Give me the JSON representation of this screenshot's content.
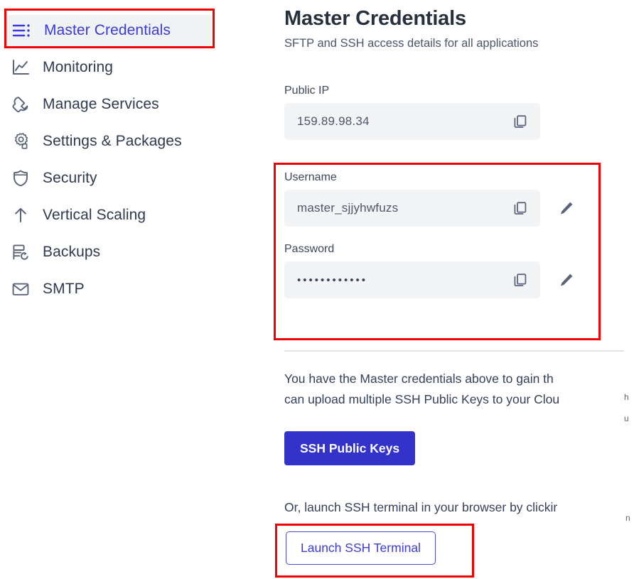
{
  "sidebar": {
    "items": [
      {
        "id": "master-credentials",
        "label": "Master Credentials",
        "icon": "list-dots-icon",
        "active": true
      },
      {
        "id": "monitoring",
        "label": "Monitoring",
        "icon": "chart-line-icon",
        "active": false
      },
      {
        "id": "manage-services",
        "label": "Manage Services",
        "icon": "wrench-icon",
        "active": false
      },
      {
        "id": "settings-packages",
        "label": "Settings & Packages",
        "icon": "gear-icon",
        "active": false
      },
      {
        "id": "security",
        "label": "Security",
        "icon": "shield-icon",
        "active": false
      },
      {
        "id": "vertical-scaling",
        "label": "Vertical Scaling",
        "icon": "arrow-up-icon",
        "active": false
      },
      {
        "id": "backups",
        "label": "Backups",
        "icon": "backup-icon",
        "active": false
      },
      {
        "id": "smtp",
        "label": "SMTP",
        "icon": "envelope-icon",
        "active": false
      }
    ]
  },
  "main": {
    "title": "Master Credentials",
    "subtitle": "SFTP and SSH access details for all applications",
    "fields": [
      {
        "id": "public-ip",
        "label": "Public IP",
        "value": "159.89.98.34",
        "masked": false,
        "editable": false
      },
      {
        "id": "username",
        "label": "Username",
        "value": "master_sjjyhwfuzs",
        "masked": false,
        "editable": true
      },
      {
        "id": "password",
        "label": "Password",
        "value": "••••••••••••",
        "masked": true,
        "editable": true
      }
    ],
    "info_paragraph_line1": "You have the Master credentials above to gain th",
    "info_paragraph_line2": "can upload multiple SSH Public Keys to your Clou",
    "info_paragraph_clip1": "h",
    "info_paragraph_clip2": "u",
    "ssh_keys_button": "SSH Public Keys",
    "terminal_paragraph": "Or, launch SSH terminal in your browser by clickir",
    "terminal_paragraph_clip": "n",
    "launch_terminal_button": "Launch SSH Terminal"
  },
  "colors": {
    "accent_blue": "#3333cc",
    "link_blue": "#3b3bdb",
    "text_dark": "#27303f",
    "text_body": "#36405a",
    "field_bg": "#f3f4f6",
    "active_nav_bg": "#f1f2f4",
    "highlight_red": "#f40000"
  },
  "annotations": {
    "highlight_boxes": [
      {
        "id": "nav-master-credentials-highlight",
        "target": "sidebar-item-master-credentials"
      },
      {
        "id": "credentials-highlight",
        "target": "credentials-fields"
      },
      {
        "id": "launch-terminal-highlight",
        "target": "launch-terminal-button"
      }
    ]
  }
}
